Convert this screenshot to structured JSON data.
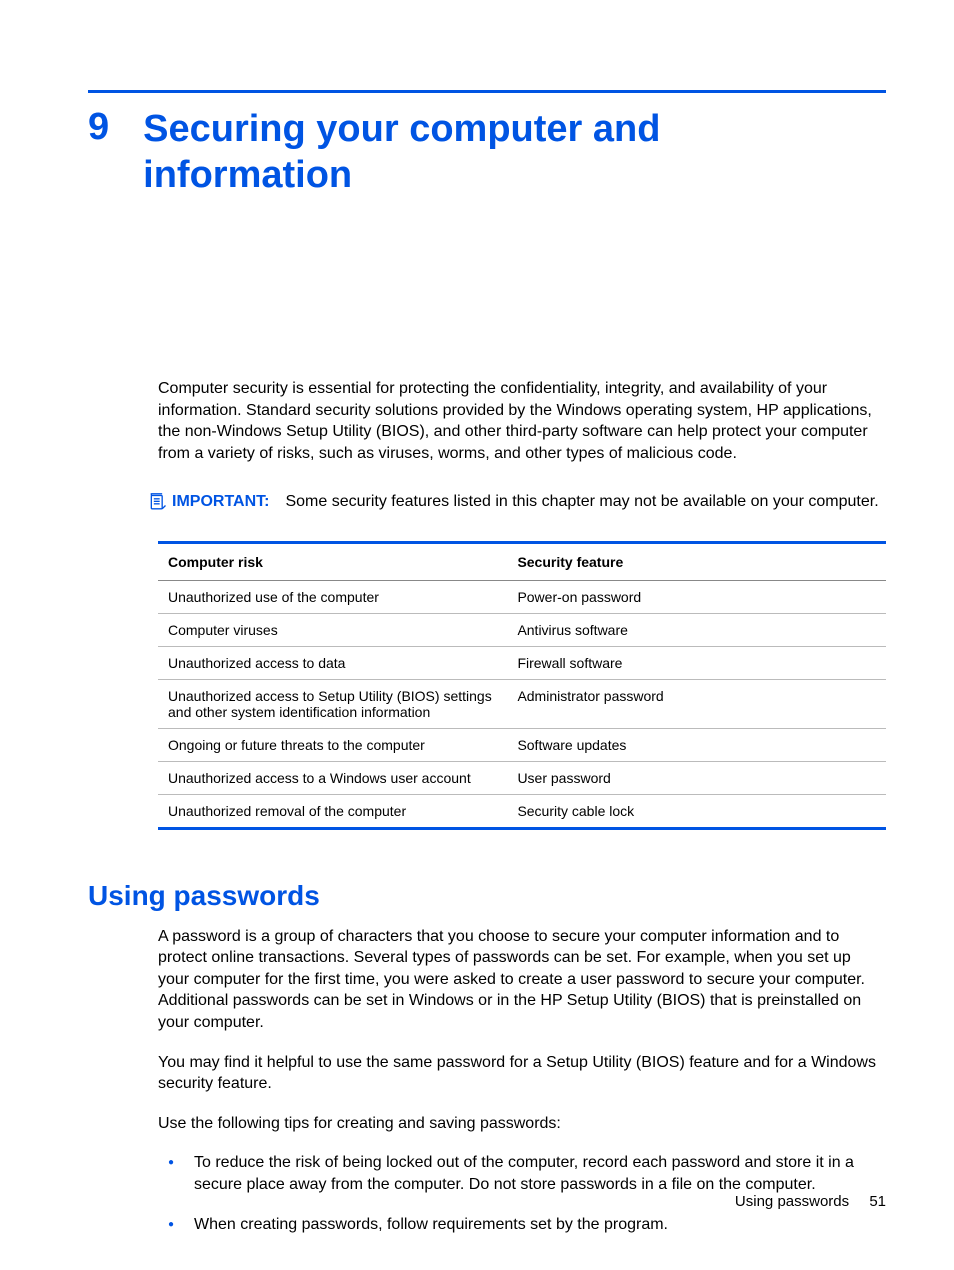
{
  "chapter": {
    "number": "9",
    "title": "Securing your computer and information"
  },
  "intro": "Computer security is essential for protecting the confidentiality, integrity, and availability of your information. Standard security solutions provided by the Windows operating system, HP applications, the non-Windows Setup Utility (BIOS), and other third-party software can help protect your computer from a variety of risks, such as viruses, worms, and other types of malicious code.",
  "note": {
    "label": "IMPORTANT:",
    "text": "Some security features listed in this chapter may not be available on your computer."
  },
  "table": {
    "headers": {
      "risk": "Computer risk",
      "feature": "Security feature"
    },
    "rows": [
      {
        "risk": "Unauthorized use of the computer",
        "feature": "Power-on password"
      },
      {
        "risk": "Computer viruses",
        "feature": "Antivirus software"
      },
      {
        "risk": "Unauthorized access to data",
        "feature": "Firewall software"
      },
      {
        "risk": "Unauthorized access to Setup Utility (BIOS) settings and other system identification information",
        "feature": "Administrator password"
      },
      {
        "risk": "Ongoing or future threats to the computer",
        "feature": "Software updates"
      },
      {
        "risk": "Unauthorized access to a Windows user account",
        "feature": "User password"
      },
      {
        "risk": "Unauthorized removal of the computer",
        "feature": "Security cable lock"
      }
    ]
  },
  "section": {
    "title": "Using passwords",
    "p1": "A password is a group of characters that you choose to secure your computer information and to protect online transactions. Several types of passwords can be set. For example, when you set up your computer for the first time, you were asked to create a user password to secure your computer. Additional passwords can be set in Windows or in the HP Setup Utility (BIOS) that is preinstalled on your computer.",
    "p2": "You may find it helpful to use the same password for a Setup Utility (BIOS) feature and for a Windows security feature.",
    "p3": "Use the following tips for creating and saving passwords:",
    "tips": [
      "To reduce the risk of being locked out of the computer, record each password and store it in a secure place away from the computer. Do not store passwords in a file on the computer.",
      "When creating passwords, follow requirements set by the program."
    ]
  },
  "footer": {
    "label": "Using passwords",
    "page": "51"
  }
}
